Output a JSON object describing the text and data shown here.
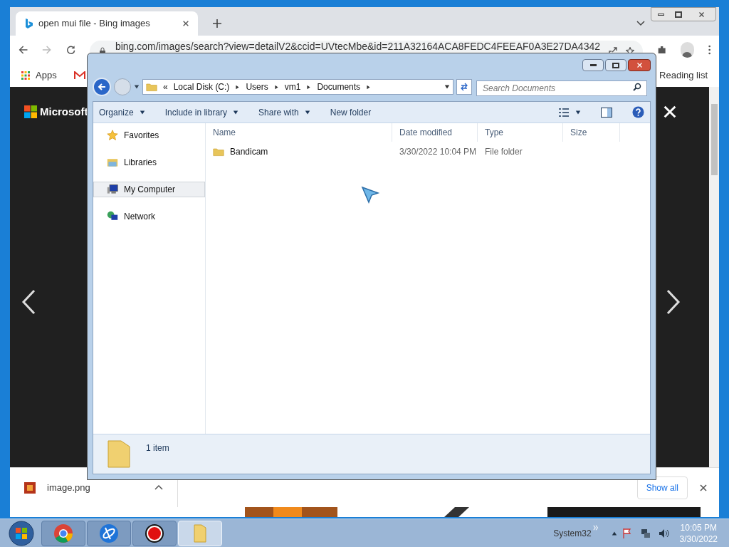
{
  "browser": {
    "tab": {
      "title": "open mui file - Bing images"
    },
    "url": "bing.com/images/search?view=detailV2&ccid=UVtecMbe&id=211A32164ACA8FEDC4FEEAF0A3E27DA4342",
    "bookmarks": [
      {
        "label": "Apps",
        "kind": "apps"
      }
    ],
    "reading_list": "Reading list",
    "page": {
      "brand": "Microsoft"
    },
    "download": {
      "file": "image.png"
    },
    "show_all": "Show all"
  },
  "explorer": {
    "breadcrumb": [
      "«",
      "Local Disk (C:)",
      "Users",
      "vm1",
      "Documents"
    ],
    "search_placeholder": "Search Documents",
    "toolbar": [
      {
        "label": "Organize",
        "menu": true
      },
      {
        "label": "Include in library",
        "menu": true
      },
      {
        "label": "Share with",
        "menu": true
      },
      {
        "label": "New folder",
        "menu": false
      }
    ],
    "nav": [
      {
        "label": "Favorites",
        "kind": "star",
        "selected": false
      },
      {
        "label": "Libraries",
        "kind": "library",
        "selected": false
      },
      {
        "label": "My Computer",
        "kind": "computer",
        "selected": true
      },
      {
        "label": "Network",
        "kind": "network",
        "selected": false
      }
    ],
    "columns": [
      "Name",
      "Date modified",
      "Type",
      "Size"
    ],
    "rows": [
      {
        "name": "Bandicam",
        "date": "3/30/2022 10:04 PM",
        "type": "File folder"
      }
    ],
    "status": "1 item"
  },
  "taskbar": {
    "apps": [
      {
        "kind": "chrome",
        "selected": false
      },
      {
        "kind": "blue",
        "selected": false
      },
      {
        "kind": "record",
        "selected": false
      },
      {
        "kind": "folder",
        "selected": true
      }
    ],
    "toolbar_label": "System32",
    "time": "10:05 PM",
    "date": "3/30/2022"
  }
}
